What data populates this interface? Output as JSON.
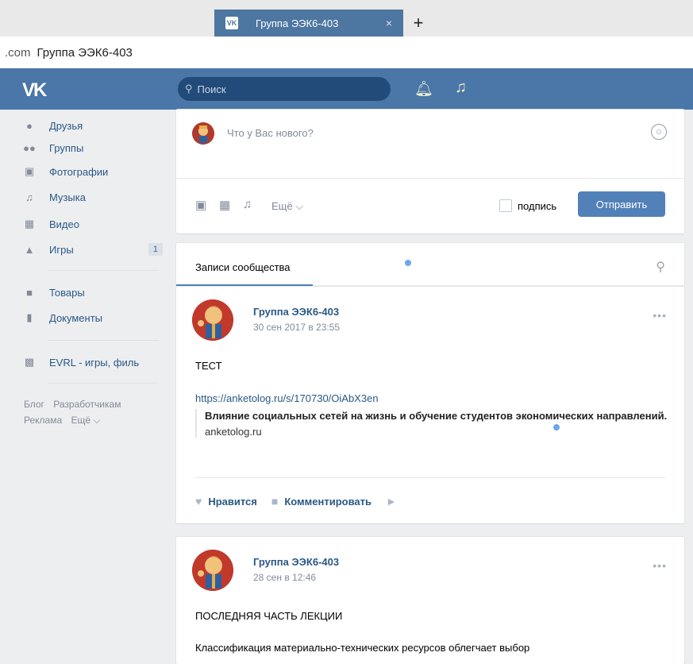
{
  "browser": {
    "tab_favicon": "VK",
    "tab_title": "Группа ЭЭК6-403",
    "tab_close": "×",
    "new_tab": "+",
    "domain": ".com",
    "page_title": "Группа ЭЭК6-403"
  },
  "header": {
    "logo": "VK",
    "search_placeholder": "Поиск"
  },
  "sidebar": {
    "items": [
      {
        "label": "Друзья",
        "icon": "friends-icon"
      },
      {
        "label": "Группы",
        "icon": "groups-icon"
      },
      {
        "label": "Фотографии",
        "icon": "photos-icon"
      },
      {
        "label": "Музыка",
        "icon": "music-icon"
      },
      {
        "label": "Видео",
        "icon": "video-icon"
      },
      {
        "label": "Игры",
        "icon": "games-icon",
        "badge": "1"
      },
      {
        "label": "Товары",
        "icon": "goods-icon"
      },
      {
        "label": "Документы",
        "icon": "documents-icon"
      },
      {
        "label": "EVRL - игры, филь",
        "icon": "app-icon"
      }
    ],
    "footer": {
      "blog": "Блог",
      "developers": "Разработчикам",
      "ads": "Реклама",
      "more": "Ещё ⌵"
    }
  },
  "composer": {
    "placeholder": "Что у Вас нового?",
    "more": "Ещё ⌵",
    "signature_label": "подпись",
    "send_button": "Отправить"
  },
  "wall": {
    "tab": "Записи сообщества"
  },
  "posts": [
    {
      "author": "Группа ЭЭК6-403",
      "date": "30 сен 2017 в 23:55",
      "text": "ТЕСТ",
      "link": "https://anketolog.ru/s/170730/OiAbX3en",
      "snippet_title": "Влияние социальных сетей на жизнь и обучение студентов экономических направлений.",
      "snippet_domain": "anketolog.ru",
      "like_label": "Нравится",
      "comment_label": "Комментировать"
    },
    {
      "author": "Группа ЭЭК6-403",
      "date": "28 сен в 12:46",
      "text": "ПОСЛЕДНЯЯ ЧАСТЬ ЛЕКЦИИ",
      "body": "Классификация материально-технических ресурсов облегчает выбор"
    }
  ],
  "colors": {
    "header": "#4a76a8",
    "link": "#2a5885",
    "button": "#5181b8"
  }
}
